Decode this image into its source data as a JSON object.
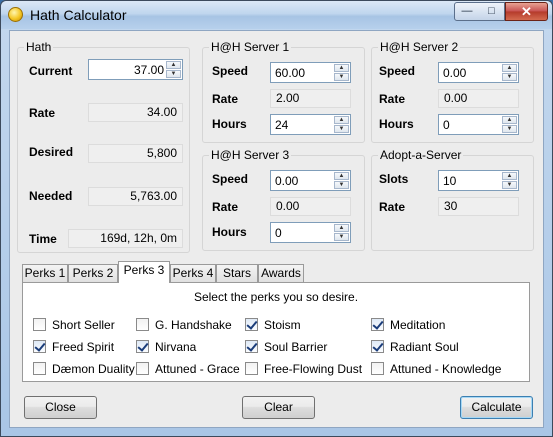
{
  "window": {
    "title": "Hath Calculator",
    "controls": {
      "minimize": "—",
      "maximize": "□",
      "close": "✕"
    }
  },
  "hath": {
    "title": "Hath",
    "current_label": "Current",
    "current_value": "37.00",
    "rate_label": "Rate",
    "rate_value": "34.00",
    "desired_label": "Desired",
    "desired_value": "5,800",
    "needed_label": "Needed",
    "needed_value": "5,763.00",
    "time_label": "Time",
    "time_value": "169d, 12h, 0m"
  },
  "server1": {
    "title": "H@H Server 1",
    "speed_label": "Speed",
    "speed_value": "60.00",
    "rate_label": "Rate",
    "rate_value": "2.00",
    "hours_label": "Hours",
    "hours_value": "24"
  },
  "server2": {
    "title": "H@H Server 2",
    "speed_label": "Speed",
    "speed_value": "0.00",
    "rate_label": "Rate",
    "rate_value": "0.00",
    "hours_label": "Hours",
    "hours_value": "0"
  },
  "server3": {
    "title": "H@H Server 3",
    "speed_label": "Speed",
    "speed_value": "0.00",
    "rate_label": "Rate",
    "rate_value": "0.00",
    "hours_label": "Hours",
    "hours_value": "0"
  },
  "adopt": {
    "title": "Adopt-a-Server",
    "slots_label": "Slots",
    "slots_value": "10",
    "rate_label": "Rate",
    "rate_value": "30"
  },
  "tabs": [
    {
      "label": "Perks 1",
      "active": false
    },
    {
      "label": "Perks 2",
      "active": false
    },
    {
      "label": "Perks 3",
      "active": true
    },
    {
      "label": "Perks 4",
      "active": false
    },
    {
      "label": "Stars",
      "active": false
    },
    {
      "label": "Awards",
      "active": false
    }
  ],
  "perks": {
    "heading": "Select the perks you so desire.",
    "items": [
      {
        "label": "Short Seller",
        "checked": false
      },
      {
        "label": "G. Handshake",
        "checked": false
      },
      {
        "label": "Stoism",
        "checked": true
      },
      {
        "label": "Meditation",
        "checked": true
      },
      {
        "label": "Freed Spirit",
        "checked": true
      },
      {
        "label": "Nirvana",
        "checked": true
      },
      {
        "label": "Soul Barrier",
        "checked": true
      },
      {
        "label": "Radiant Soul",
        "checked": true
      },
      {
        "label": "Dæmon Duality",
        "checked": false
      },
      {
        "label": "Attuned - Grace",
        "checked": false
      },
      {
        "label": "Free-Flowing Dust",
        "checked": false
      },
      {
        "label": "Attuned - Knowledge",
        "checked": false
      }
    ]
  },
  "buttons": {
    "close": "Close",
    "clear": "Clear",
    "calculate": "Calculate"
  },
  "icons": {
    "spin_up": "▲",
    "spin_down": "▼"
  }
}
